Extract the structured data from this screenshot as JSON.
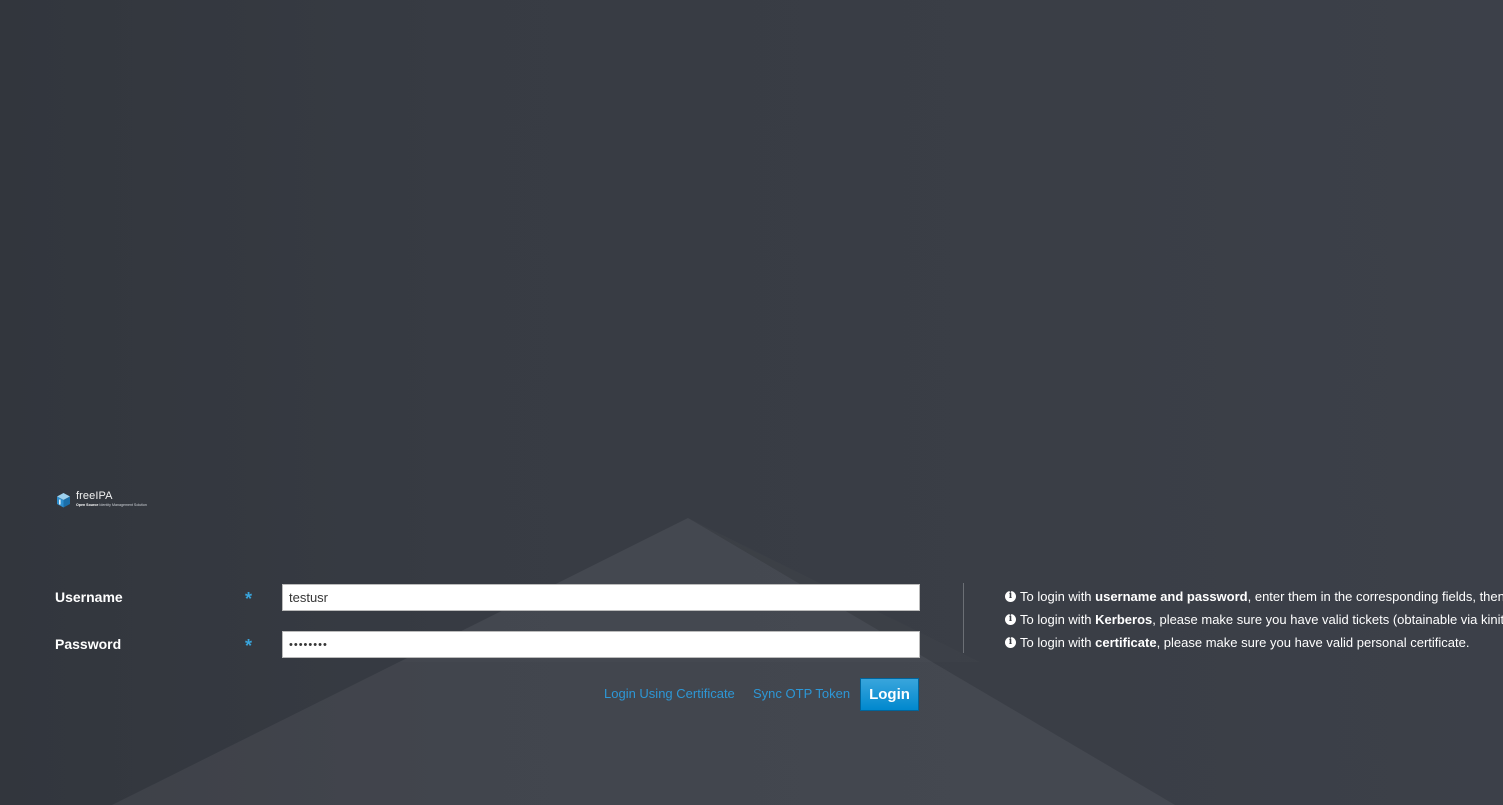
{
  "brand": {
    "name": "freeIPA",
    "tagline_bold": "Open Source",
    "tagline_rest": "Identity Management Solution"
  },
  "form": {
    "username": {
      "label": "Username",
      "required_mark": "*",
      "value": "testusr"
    },
    "password": {
      "label": "Password",
      "required_mark": "*",
      "value": "••••••••"
    },
    "links": {
      "certificate": "Login Using Certificate",
      "sync_otp": "Sync OTP Token"
    },
    "login_button": "Login"
  },
  "help": [
    {
      "icon": "info-icon",
      "prefix": "To login with ",
      "emphasis": "username and password",
      "suffix": ", enter them in the corresponding fields, then click Login."
    },
    {
      "icon": "info-icon",
      "prefix": "To login with ",
      "emphasis": "Kerberos",
      "suffix": ", please make sure you have valid tickets (obtainable via kinit) and configured the browser correctly, then click Login."
    },
    {
      "icon": "info-icon",
      "prefix": "To login with ",
      "emphasis": "certificate",
      "suffix": ", please make sure you have valid personal certificate."
    }
  ],
  "colors": {
    "accent": "#0088ce",
    "link": "#2d97d6",
    "required": "#39a5dc"
  }
}
